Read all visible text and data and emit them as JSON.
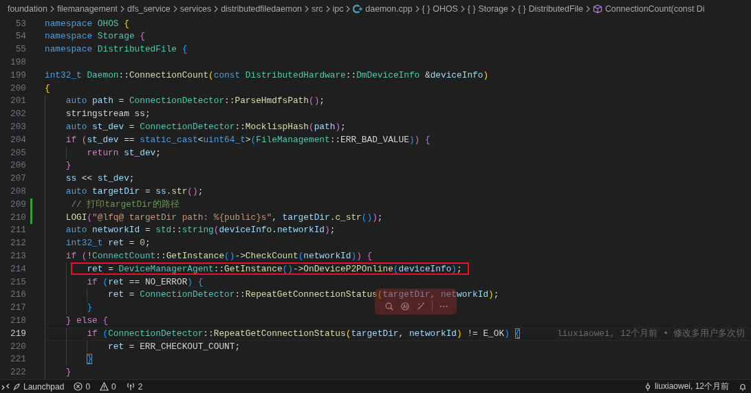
{
  "breadcrumb": [
    {
      "kind": "folder",
      "label": "foundation"
    },
    {
      "kind": "folder",
      "label": "filemanagement"
    },
    {
      "kind": "folder",
      "label": "dfs_service"
    },
    {
      "kind": "folder",
      "label": "services"
    },
    {
      "kind": "folder",
      "label": "distributedfiledaemon"
    },
    {
      "kind": "folder",
      "label": "src"
    },
    {
      "kind": "folder",
      "label": "ipc"
    },
    {
      "kind": "file",
      "label": "daemon.cpp"
    },
    {
      "kind": "namespace",
      "icon": "{ }",
      "label": "OHOS"
    },
    {
      "kind": "namespace",
      "icon": "{ }",
      "label": "Storage"
    },
    {
      "kind": "namespace",
      "icon": "{ }",
      "label": "DistributedFile"
    },
    {
      "kind": "function",
      "label": "ConnectionCount(const Di"
    }
  ],
  "lines": [
    {
      "number": "53",
      "added": false,
      "current": false,
      "boxed": false,
      "tokens": [
        {
          "kind": "kw",
          "text": "namespace"
        },
        {
          "kind": "type",
          "text": " OHOS"
        },
        {
          "kind": "b1",
          "text": " {"
        }
      ]
    },
    {
      "number": "54",
      "added": false,
      "current": false,
      "boxed": false,
      "tokens": [
        {
          "kind": "kw",
          "text": "namespace"
        },
        {
          "kind": "type",
          "text": " Storage"
        },
        {
          "kind": "b2",
          "text": " {"
        }
      ]
    },
    {
      "number": "55",
      "added": false,
      "current": false,
      "boxed": false,
      "tokens": [
        {
          "kind": "kw",
          "text": "namespace"
        },
        {
          "kind": "type",
          "text": " DistributedFile"
        },
        {
          "kind": "b3",
          "text": " {"
        }
      ]
    },
    {
      "number": "198",
      "added": false,
      "current": false,
      "boxed": false
    },
    {
      "number": "199",
      "added": false,
      "current": false,
      "boxed": false,
      "tokens": [
        {
          "kind": "kw",
          "text": "int32_t"
        },
        {
          "kind": "type",
          "text": " Daemon"
        },
        {
          "kind": "txt",
          "text": "::"
        },
        {
          "kind": "fn",
          "text": "ConnectionCount"
        },
        {
          "kind": "b1",
          "text": "("
        },
        {
          "kind": "kw",
          "text": "const"
        },
        {
          "kind": "type",
          "text": " DistributedHardware"
        },
        {
          "kind": "txt",
          "text": "::"
        },
        {
          "kind": "type",
          "text": "DmDeviceInfo"
        },
        {
          "kind": "txt",
          "text": " &"
        },
        {
          "kind": "var",
          "text": "deviceInfo"
        },
        {
          "kind": "b1",
          "text": ")"
        }
      ]
    },
    {
      "number": "200",
      "added": false,
      "current": false,
      "boxed": false,
      "tokens": [
        {
          "kind": "b1",
          "text": "{"
        }
      ]
    },
    {
      "number": "201",
      "added": false,
      "current": false,
      "boxed": false,
      "tokens": [
        {
          "kind": "kw",
          "text": "    auto"
        },
        {
          "kind": "var",
          "text": " path"
        },
        {
          "kind": "txt",
          "text": " = "
        },
        {
          "kind": "type",
          "text": "ConnectionDetector"
        },
        {
          "kind": "txt",
          "text": "::"
        },
        {
          "kind": "fn",
          "text": "ParseHmdfsPath"
        },
        {
          "kind": "b2",
          "text": "()"
        },
        {
          "kind": "txt",
          "text": ";"
        }
      ]
    },
    {
      "number": "202",
      "added": false,
      "current": false,
      "boxed": false,
      "tokens": [
        {
          "kind": "txt",
          "text": "    stringstream ss;"
        }
      ]
    },
    {
      "number": "203",
      "added": false,
      "current": false,
      "boxed": false,
      "tokens": [
        {
          "kind": "kw",
          "text": "    auto"
        },
        {
          "kind": "var",
          "text": " st_dev"
        },
        {
          "kind": "txt",
          "text": " = "
        },
        {
          "kind": "type",
          "text": "ConnectionDetector"
        },
        {
          "kind": "txt",
          "text": "::"
        },
        {
          "kind": "fn",
          "text": "MocklispHash"
        },
        {
          "kind": "b2",
          "text": "("
        },
        {
          "kind": "var",
          "text": "path"
        },
        {
          "kind": "b2",
          "text": ")"
        },
        {
          "kind": "txt",
          "text": ";"
        }
      ]
    },
    {
      "number": "204",
      "added": false,
      "current": false,
      "boxed": false,
      "tokens": [
        {
          "kind": "ctl",
          "text": "    if"
        },
        {
          "kind": "b2",
          "text": " ("
        },
        {
          "kind": "var",
          "text": "st_dev"
        },
        {
          "kind": "txt",
          "text": " == "
        },
        {
          "kind": "kw",
          "text": "static_cast"
        },
        {
          "kind": "txt",
          "text": "<"
        },
        {
          "kind": "kw",
          "text": "uint64_t"
        },
        {
          "kind": "txt",
          "text": ">"
        },
        {
          "kind": "b3",
          "text": "("
        },
        {
          "kind": "type",
          "text": "FileManagement"
        },
        {
          "kind": "txt",
          "text": "::ERR_BAD_VALUE"
        },
        {
          "kind": "b3",
          "text": ")"
        },
        {
          "kind": "b2",
          "text": ")"
        },
        {
          "kind": "b2",
          "text": " {"
        }
      ]
    },
    {
      "number": "205",
      "added": false,
      "current": false,
      "boxed": false,
      "tokens": [
        {
          "kind": "ctl",
          "text": "        return"
        },
        {
          "kind": "var",
          "text": " st_dev"
        },
        {
          "kind": "txt",
          "text": ";"
        }
      ]
    },
    {
      "number": "206",
      "added": false,
      "current": false,
      "boxed": false,
      "tokens": [
        {
          "kind": "b2",
          "text": "    }"
        }
      ]
    },
    {
      "number": "207",
      "added": false,
      "current": false,
      "boxed": false,
      "tokens": [
        {
          "kind": "var",
          "text": "    ss"
        },
        {
          "kind": "txt",
          "text": " << "
        },
        {
          "kind": "var",
          "text": "st_dev"
        },
        {
          "kind": "txt",
          "text": ";"
        }
      ]
    },
    {
      "number": "208",
      "added": false,
      "current": false,
      "boxed": false,
      "tokens": [
        {
          "kind": "kw",
          "text": "    auto"
        },
        {
          "kind": "var",
          "text": " targetDir"
        },
        {
          "kind": "txt",
          "text": " = "
        },
        {
          "kind": "var",
          "text": "ss"
        },
        {
          "kind": "txt",
          "text": "."
        },
        {
          "kind": "fn",
          "text": "str"
        },
        {
          "kind": "b2",
          "text": "()"
        },
        {
          "kind": "txt",
          "text": ";"
        }
      ]
    },
    {
      "number": "209",
      "added": true,
      "current": false,
      "boxed": false,
      "tokens": [
        {
          "kind": "cmt",
          "text": "     // 打印targetDir的路径"
        }
      ]
    },
    {
      "number": "210",
      "added": true,
      "current": false,
      "boxed": false,
      "tokens": [
        {
          "kind": "fn",
          "text": "    LOGI"
        },
        {
          "kind": "b2",
          "text": "("
        },
        {
          "kind": "str",
          "text": "\"@lfq@ targetDir path: %{public}s\""
        },
        {
          "kind": "txt",
          "text": ", "
        },
        {
          "kind": "var",
          "text": "targetDir"
        },
        {
          "kind": "txt",
          "text": "."
        },
        {
          "kind": "fn",
          "text": "c_str"
        },
        {
          "kind": "b3",
          "text": "()"
        },
        {
          "kind": "b2",
          "text": ")"
        },
        {
          "kind": "txt",
          "text": ";"
        }
      ]
    },
    {
      "number": "211",
      "added": false,
      "current": false,
      "boxed": false,
      "tokens": [
        {
          "kind": "kw",
          "text": "    auto"
        },
        {
          "kind": "var",
          "text": " networkId"
        },
        {
          "kind": "txt",
          "text": " = "
        },
        {
          "kind": "type",
          "text": "std"
        },
        {
          "kind": "txt",
          "text": "::"
        },
        {
          "kind": "type",
          "text": "string"
        },
        {
          "kind": "b2",
          "text": "("
        },
        {
          "kind": "var",
          "text": "deviceInfo"
        },
        {
          "kind": "txt",
          "text": "."
        },
        {
          "kind": "var",
          "text": "networkId"
        },
        {
          "kind": "b2",
          "text": ")"
        },
        {
          "kind": "txt",
          "text": ";"
        }
      ]
    },
    {
      "number": "212",
      "added": false,
      "current": false,
      "boxed": false,
      "tokens": [
        {
          "kind": "kw",
          "text": "    int32_t"
        },
        {
          "kind": "var",
          "text": " ret"
        },
        {
          "kind": "txt",
          "text": " = "
        },
        {
          "kind": "num",
          "text": "0"
        },
        {
          "kind": "txt",
          "text": ";"
        }
      ]
    },
    {
      "number": "213",
      "added": false,
      "current": false,
      "boxed": false,
      "tokens": [
        {
          "kind": "ctl",
          "text": "    if"
        },
        {
          "kind": "b2",
          "text": " ("
        },
        {
          "kind": "txt",
          "text": "!"
        },
        {
          "kind": "type",
          "text": "ConnectCount"
        },
        {
          "kind": "txt",
          "text": "::"
        },
        {
          "kind": "fn",
          "text": "GetInstance"
        },
        {
          "kind": "b3",
          "text": "()"
        },
        {
          "kind": "txt",
          "text": "->"
        },
        {
          "kind": "fn",
          "text": "CheckCount"
        },
        {
          "kind": "b3",
          "text": "("
        },
        {
          "kind": "var",
          "text": "networkId"
        },
        {
          "kind": "b3",
          "text": ")"
        },
        {
          "kind": "b2",
          "text": ")"
        },
        {
          "kind": "b2",
          "text": " {"
        }
      ]
    },
    {
      "number": "214",
      "added": false,
      "current": false,
      "boxed": true,
      "tokens": [
        {
          "kind": "var",
          "text": "        ret"
        },
        {
          "kind": "txt",
          "text": " = "
        },
        {
          "kind": "type",
          "text": "DeviceManagerAgent"
        },
        {
          "kind": "txt",
          "text": "::"
        },
        {
          "kind": "fn",
          "text": "GetInstance"
        },
        {
          "kind": "b3",
          "text": "()"
        },
        {
          "kind": "txt",
          "text": "->"
        },
        {
          "kind": "fn",
          "text": "OnDeviceP2POnline"
        },
        {
          "kind": "b3",
          "text": "("
        },
        {
          "kind": "var",
          "text": "deviceInfo"
        },
        {
          "kind": "b3",
          "text": ")"
        },
        {
          "kind": "txt",
          "text": ";"
        }
      ]
    },
    {
      "number": "215",
      "added": false,
      "current": false,
      "boxed": false,
      "tokens": [
        {
          "kind": "ctl",
          "text": "        if"
        },
        {
          "kind": "b3",
          "text": " ("
        },
        {
          "kind": "var",
          "text": "ret"
        },
        {
          "kind": "txt",
          "text": " == NO_ERROR"
        },
        {
          "kind": "b3",
          "text": ")"
        },
        {
          "kind": "b3",
          "text": " {"
        }
      ]
    },
    {
      "number": "216",
      "added": false,
      "current": false,
      "boxed": false,
      "tokens": [
        {
          "kind": "var",
          "text": "            ret"
        },
        {
          "kind": "txt",
          "text": " = "
        },
        {
          "kind": "type",
          "text": "ConnectionDetector"
        },
        {
          "kind": "txt",
          "text": "::"
        },
        {
          "kind": "fn",
          "text": "RepeatGetConnectionStatus"
        },
        {
          "kind": "b1",
          "text": "("
        },
        {
          "kind": "var",
          "text": "targetDir"
        },
        {
          "kind": "txt",
          "text": ", "
        },
        {
          "kind": "var",
          "text": "networkId"
        },
        {
          "kind": "b1",
          "text": ")"
        },
        {
          "kind": "txt",
          "text": ";"
        }
      ]
    },
    {
      "number": "217",
      "added": false,
      "current": false,
      "boxed": false,
      "tokens": [
        {
          "kind": "b3",
          "text": "        }"
        }
      ]
    },
    {
      "number": "218",
      "added": false,
      "current": false,
      "boxed": false,
      "tokens": [
        {
          "kind": "b2",
          "text": "    }"
        },
        {
          "kind": "ctl",
          "text": " else"
        },
        {
          "kind": "b2",
          "text": " {"
        }
      ]
    },
    {
      "number": "219",
      "added": false,
      "current": true,
      "boxed": false,
      "blame": "liuxiaowei, 12个月前 • 修改多用户多次切",
      "tokens": [
        {
          "kind": "ctl",
          "text": "        if"
        },
        {
          "kind": "b3",
          "text": " ("
        },
        {
          "kind": "type",
          "text": "ConnectionDetector"
        },
        {
          "kind": "txt",
          "text": "::"
        },
        {
          "kind": "fn",
          "text": "RepeatGetConnectionStatus"
        },
        {
          "kind": "b1",
          "text": "("
        },
        {
          "kind": "var",
          "text": "targetDir"
        },
        {
          "kind": "txt",
          "text": ", "
        },
        {
          "kind": "var",
          "text": "networkId"
        },
        {
          "kind": "b1",
          "text": ")"
        },
        {
          "kind": "txt",
          "text": " != E_OK"
        },
        {
          "kind": "b3",
          "text": ") "
        },
        {
          "kind": "match",
          "text": "{"
        }
      ]
    },
    {
      "number": "220",
      "added": false,
      "current": false,
      "boxed": false,
      "tokens": [
        {
          "kind": "var",
          "text": "            ret"
        },
        {
          "kind": "txt",
          "text": " = ERR_CHECKOUT_COUNT;"
        }
      ]
    },
    {
      "number": "221",
      "added": false,
      "current": false,
      "boxed": false,
      "tokens": [
        {
          "kind": "match",
          "text": "        }"
        }
      ]
    },
    {
      "number": "222",
      "added": false,
      "current": false,
      "boxed": false,
      "tokens": [
        {
          "kind": "b2",
          "text": "    }"
        }
      ]
    }
  ],
  "status_bar": {
    "left": [
      {
        "kind": "launchpad",
        "text": "Launchpad"
      },
      {
        "kind": "errors",
        "text": "0"
      },
      {
        "kind": "warnings",
        "text": "0"
      },
      {
        "kind": "broadcast",
        "text": "2"
      }
    ],
    "right": [
      {
        "kind": "blame",
        "text": "liuxiaowei, 12个月前"
      },
      {
        "kind": "bell"
      }
    ]
  }
}
